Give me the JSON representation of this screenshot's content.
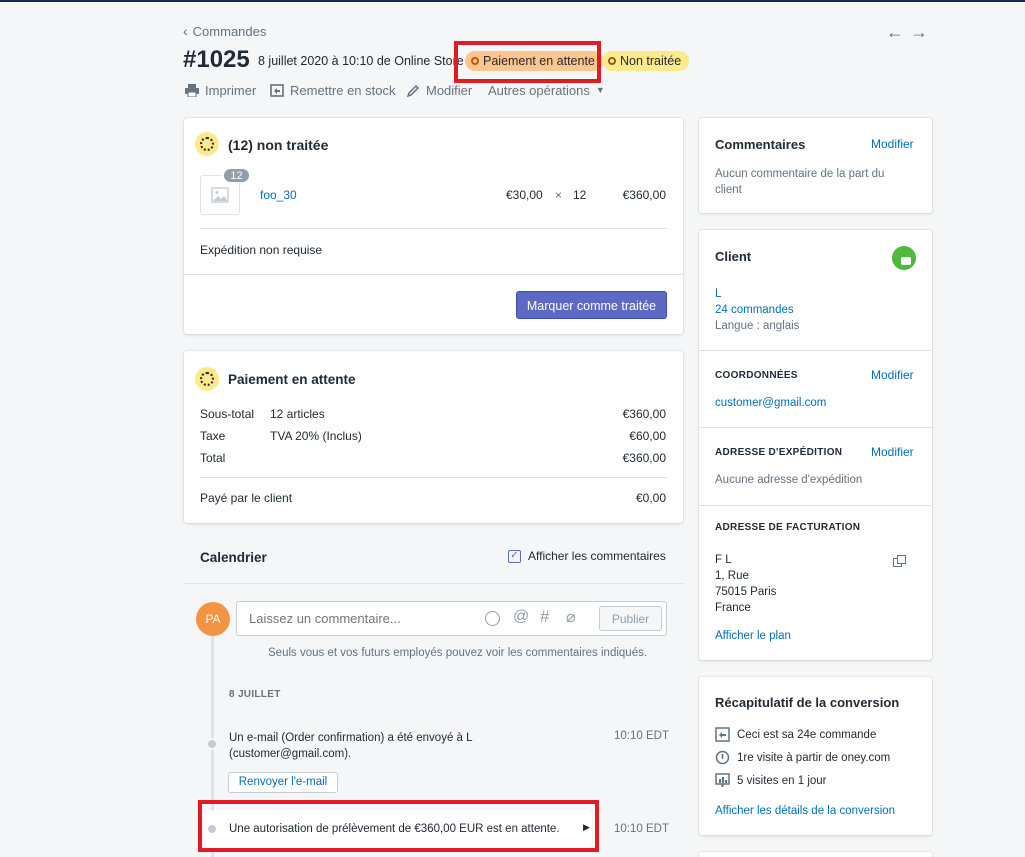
{
  "header": {
    "back_label": "Commandes",
    "order_number": "#1025",
    "order_meta": "8 juillet 2020 à 10:10 de Online Store",
    "badge_payment": "Paiement en attente",
    "badge_fulfillment": "Non traitée"
  },
  "toolbar": {
    "print": "Imprimer",
    "restock": "Remettre en stock",
    "edit": "Modifier",
    "more": "Autres opérations"
  },
  "fulfillment": {
    "title": "(12) non traitée",
    "qty_badge": "12",
    "product_name": "foo_30",
    "unit_price": "€30,00",
    "times": "×",
    "quantity": "12",
    "line_total": "€360,00",
    "shipping_note": "Expédition non requise",
    "action": "Marquer comme traitée"
  },
  "payment": {
    "title": "Paiement en attente",
    "rows": [
      {
        "label": "Sous-total",
        "detail": "12 articles",
        "amount": "€360,00"
      },
      {
        "label": "Taxe",
        "detail": "TVA 20% (Inclus)",
        "amount": "€60,00"
      },
      {
        "label": "Total",
        "detail": "",
        "amount": "€360,00"
      }
    ],
    "paid_label": "Payé par le client",
    "paid_amount": "€0,00"
  },
  "timeline": {
    "title": "Calendrier",
    "show_comments": "Afficher les commentaires",
    "avatar": "PA",
    "comment_placeholder": "Laissez un commentaire...",
    "publish": "Publier",
    "note": "Seuls vous et vos futurs employés pouvez voir les commentaires indiqués.",
    "date_header": "8 JUILLET",
    "events": [
      {
        "text_line1": "Un e-mail (Order confirmation) a été envoyé à L",
        "text_line2": "(customer@gmail.com).",
        "time": "10:10 EDT",
        "action": "Renvoyer l'e-mail"
      },
      {
        "text": "Une autorisation de prélèvement de €360,00 EUR est en attente.",
        "time": "10:10 EDT"
      }
    ]
  },
  "comments_card": {
    "title": "Commentaires",
    "edit": "Modifier",
    "body_line1": "Aucun commentaire de la part du",
    "body_line2": "client"
  },
  "client_card": {
    "title": "Client",
    "name": "L",
    "orders": "24 commandes",
    "language": "Langue : anglais",
    "contact_title": "COORDONNÉES",
    "contact_edit": "Modifier",
    "email": "customer@gmail.com",
    "shipping_title": "ADRESSE D'EXPÉDITION",
    "shipping_edit": "Modifier",
    "shipping_none": "Aucune adresse d'expédition",
    "billing_title": "ADRESSE DE FACTURATION",
    "billing_lines": [
      "F L",
      "1, Rue",
      "75015 Paris",
      "France"
    ],
    "map_link": "Afficher le plan"
  },
  "conversion_card": {
    "title": "Récapitulatif de la conversion",
    "items": [
      "Ceci est sa 24e commande",
      "1re visite à partir de oney.com",
      "5 visites en 1 jour"
    ],
    "details_link": "Afficher les détails de la conversion"
  },
  "colors": {
    "primary": "#5c6ac4",
    "link": "#006fbb",
    "badge_payment_bg": "#ffc58b",
    "badge_fulfillment_bg": "#ffea8a",
    "highlight": "#e01b23",
    "avatar_bg": "#f49342"
  }
}
